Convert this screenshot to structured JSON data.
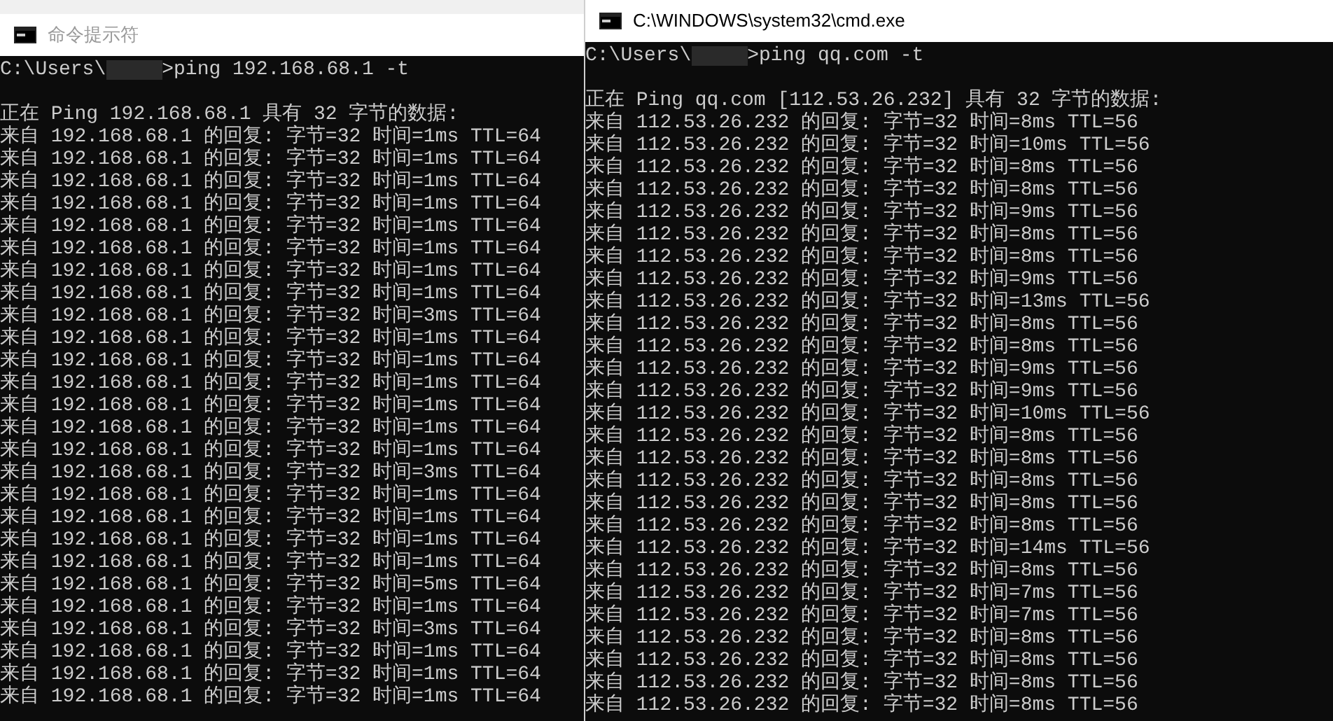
{
  "windows": [
    {
      "title": "命令提示符",
      "active": false,
      "prompt": {
        "path": "C:\\Users\\",
        "command": ">ping 192.168.68.1 -t"
      },
      "header": "正在 Ping 192.168.68.1 具有 32 字节的数据:",
      "replies": [
        "来自 192.168.68.1 的回复: 字节=32 时间=1ms TTL=64",
        "来自 192.168.68.1 的回复: 字节=32 时间=1ms TTL=64",
        "来自 192.168.68.1 的回复: 字节=32 时间=1ms TTL=64",
        "来自 192.168.68.1 的回复: 字节=32 时间=1ms TTL=64",
        "来自 192.168.68.1 的回复: 字节=32 时间=1ms TTL=64",
        "来自 192.168.68.1 的回复: 字节=32 时间=1ms TTL=64",
        "来自 192.168.68.1 的回复: 字节=32 时间=1ms TTL=64",
        "来自 192.168.68.1 的回复: 字节=32 时间=1ms TTL=64",
        "来自 192.168.68.1 的回复: 字节=32 时间=3ms TTL=64",
        "来自 192.168.68.1 的回复: 字节=32 时间=1ms TTL=64",
        "来自 192.168.68.1 的回复: 字节=32 时间=1ms TTL=64",
        "来自 192.168.68.1 的回复: 字节=32 时间=1ms TTL=64",
        "来自 192.168.68.1 的回复: 字节=32 时间=1ms TTL=64",
        "来自 192.168.68.1 的回复: 字节=32 时间=1ms TTL=64",
        "来自 192.168.68.1 的回复: 字节=32 时间=1ms TTL=64",
        "来自 192.168.68.1 的回复: 字节=32 时间=3ms TTL=64",
        "来自 192.168.68.1 的回复: 字节=32 时间=1ms TTL=64",
        "来自 192.168.68.1 的回复: 字节=32 时间=1ms TTL=64",
        "来自 192.168.68.1 的回复: 字节=32 时间=1ms TTL=64",
        "来自 192.168.68.1 的回复: 字节=32 时间=1ms TTL=64",
        "来自 192.168.68.1 的回复: 字节=32 时间=5ms TTL=64",
        "来自 192.168.68.1 的回复: 字节=32 时间=1ms TTL=64",
        "来自 192.168.68.1 的回复: 字节=32 时间=3ms TTL=64",
        "来自 192.168.68.1 的回复: 字节=32 时间=1ms TTL=64",
        "来自 192.168.68.1 的回复: 字节=32 时间=1ms TTL=64",
        "来自 192.168.68.1 的回复: 字节=32 时间=1ms TTL=64"
      ]
    },
    {
      "title": "C:\\WINDOWS\\system32\\cmd.exe",
      "active": true,
      "prompt": {
        "path": "C:\\Users\\",
        "command": ">ping qq.com -t"
      },
      "header": "正在 Ping qq.com [112.53.26.232] 具有 32 字节的数据:",
      "replies": [
        "来自 112.53.26.232 的回复: 字节=32 时间=8ms TTL=56",
        "来自 112.53.26.232 的回复: 字节=32 时间=10ms TTL=56",
        "来自 112.53.26.232 的回复: 字节=32 时间=8ms TTL=56",
        "来自 112.53.26.232 的回复: 字节=32 时间=8ms TTL=56",
        "来自 112.53.26.232 的回复: 字节=32 时间=9ms TTL=56",
        "来自 112.53.26.232 的回复: 字节=32 时间=8ms TTL=56",
        "来自 112.53.26.232 的回复: 字节=32 时间=8ms TTL=56",
        "来自 112.53.26.232 的回复: 字节=32 时间=9ms TTL=56",
        "来自 112.53.26.232 的回复: 字节=32 时间=13ms TTL=56",
        "来自 112.53.26.232 的回复: 字节=32 时间=8ms TTL=56",
        "来自 112.53.26.232 的回复: 字节=32 时间=8ms TTL=56",
        "来自 112.53.26.232 的回复: 字节=32 时间=9ms TTL=56",
        "来自 112.53.26.232 的回复: 字节=32 时间=9ms TTL=56",
        "来自 112.53.26.232 的回复: 字节=32 时间=10ms TTL=56",
        "来自 112.53.26.232 的回复: 字节=32 时间=8ms TTL=56",
        "来自 112.53.26.232 的回复: 字节=32 时间=8ms TTL=56",
        "来自 112.53.26.232 的回复: 字节=32 时间=8ms TTL=56",
        "来自 112.53.26.232 的回复: 字节=32 时间=8ms TTL=56",
        "来自 112.53.26.232 的回复: 字节=32 时间=8ms TTL=56",
        "来自 112.53.26.232 的回复: 字节=32 时间=14ms TTL=56",
        "来自 112.53.26.232 的回复: 字节=32 时间=8ms TTL=56",
        "来自 112.53.26.232 的回复: 字节=32 时间=7ms TTL=56",
        "来自 112.53.26.232 的回复: 字节=32 时间=7ms TTL=56",
        "来自 112.53.26.232 的回复: 字节=32 时间=8ms TTL=56",
        "来自 112.53.26.232 的回复: 字节=32 时间=8ms TTL=56",
        "来自 112.53.26.232 的回复: 字节=32 时间=8ms TTL=56",
        "来自 112.53.26.232 的回复: 字节=32 时间=8ms TTL=56"
      ]
    }
  ]
}
